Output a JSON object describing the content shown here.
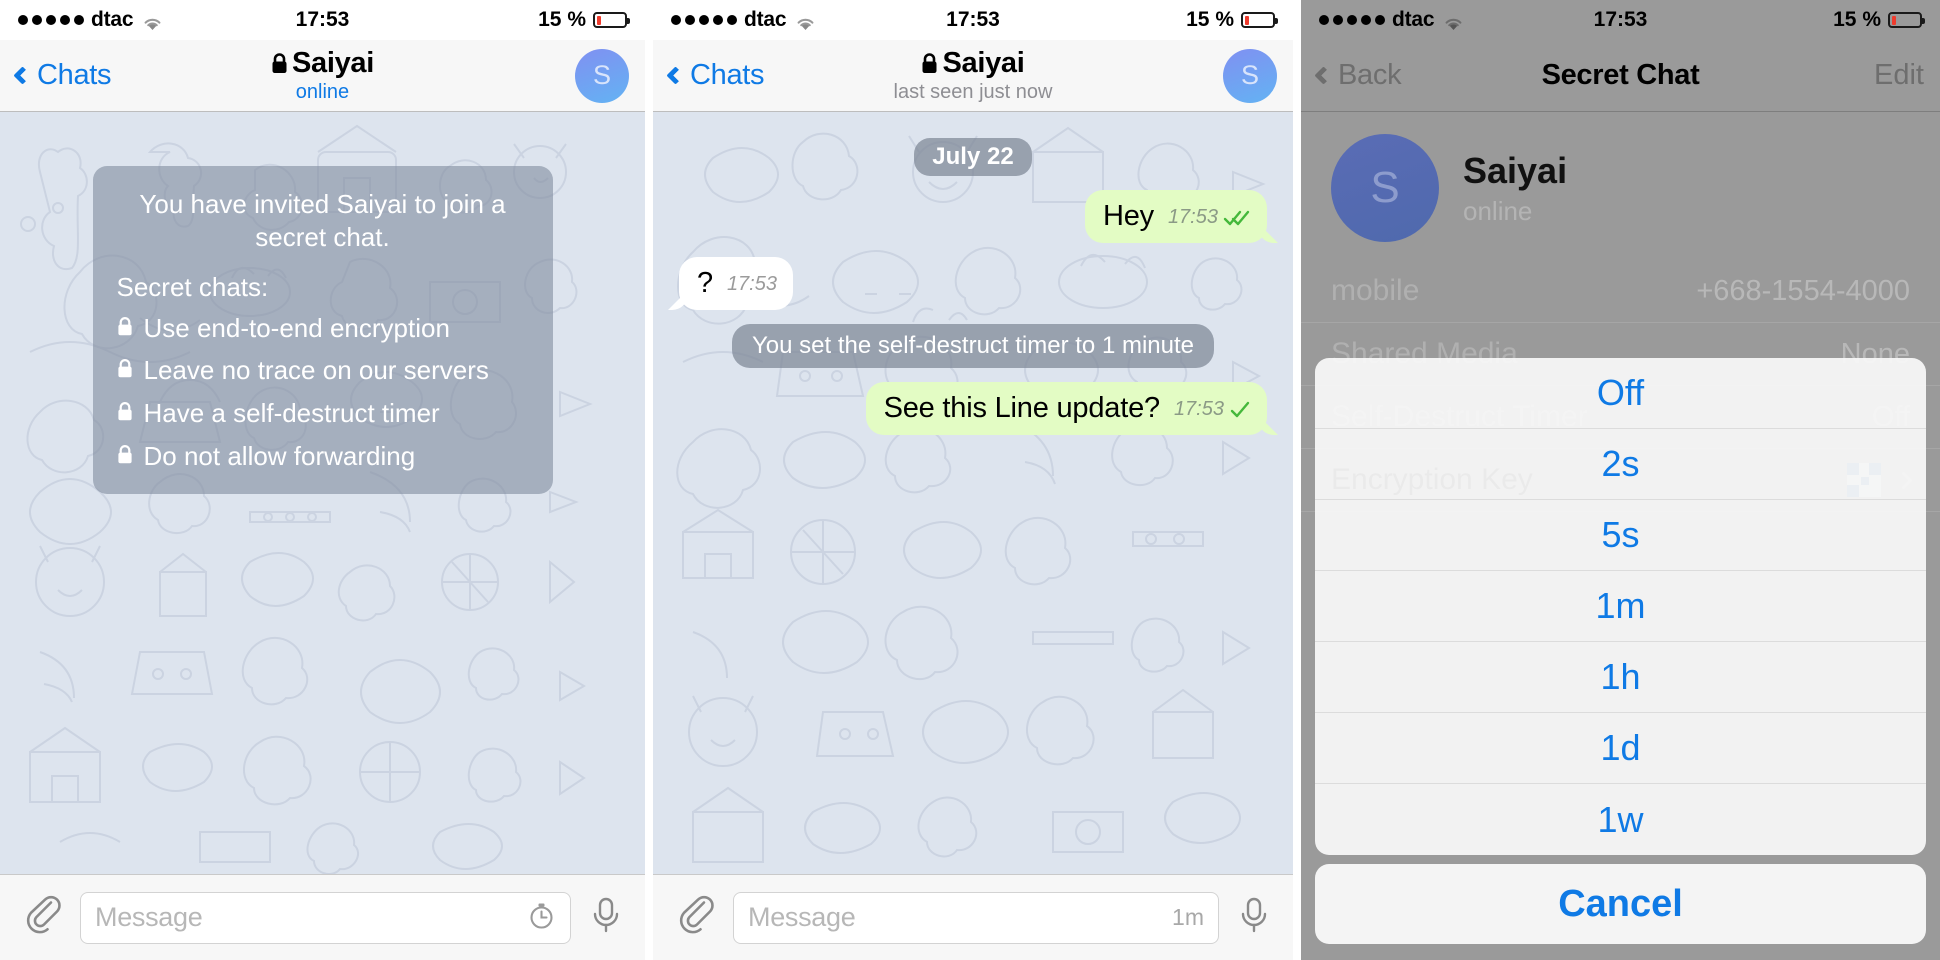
{
  "status_bar": {
    "carrier": "dtac",
    "signal_dots": 5,
    "wifi_icon": "wifi-icon",
    "time": "17:53",
    "battery_percent": "15 %",
    "battery_level": 15,
    "battery_color": "#ef3b2d"
  },
  "colors": {
    "accent_blue": "#0f7ae5",
    "outgoing_bubble": "#e3fcc4",
    "incoming_bubble": "#ffffff",
    "chat_background": "#dde4ee",
    "service_bubble": "rgba(125,135,150,.72)",
    "dimmed_overlay": "#9a9a9a",
    "tick_green": "#45b83b"
  },
  "panel1": {
    "nav": {
      "back_label": "Chats",
      "title": "Saiyai",
      "lock_icon": "lock-icon",
      "subtitle": "online",
      "avatar_initial": "S"
    },
    "info_bubble": {
      "heading": "You have invited Saiyai to join a secret chat.",
      "subheading": "Secret chats:",
      "items": [
        "Use end-to-end encryption",
        "Leave no trace on our servers",
        "Have a self-destruct timer",
        "Do not allow forwarding"
      ]
    },
    "input": {
      "attach_icon": "paperclip-icon",
      "placeholder": "Message",
      "timer_icon": "stopwatch-icon",
      "mic_icon": "microphone-icon"
    }
  },
  "panel2": {
    "nav": {
      "back_label": "Chats",
      "title": "Saiyai",
      "lock_icon": "lock-icon",
      "subtitle": "last seen just now",
      "avatar_initial": "S"
    },
    "date_separator": "July 22",
    "messages": [
      {
        "kind": "outgoing",
        "text": "Hey",
        "time": "17:53",
        "ticks": 2
      },
      {
        "kind": "incoming",
        "text": "?",
        "time": "17:53",
        "ticks": 0
      },
      {
        "kind": "service",
        "text": "You set the self-destruct timer to 1 minute"
      },
      {
        "kind": "outgoing",
        "text": "See this Line update?",
        "time": "17:53",
        "ticks": 1
      }
    ],
    "input": {
      "attach_icon": "paperclip-icon",
      "placeholder": "Message",
      "timer_value": "1m",
      "mic_icon": "microphone-icon"
    }
  },
  "panel3": {
    "nav": {
      "back_label": "Back",
      "title": "Secret Chat",
      "edit_label": "Edit"
    },
    "profile": {
      "avatar_initial": "S",
      "name": "Saiyai",
      "status": "online"
    },
    "rows": [
      {
        "label": "mobile",
        "value": "+668-1554-4000"
      },
      {
        "label": "Shared Media",
        "value": "None"
      },
      {
        "label": "Self-Destruct Timer",
        "value": "Off"
      },
      {
        "label": "Encryption Key",
        "value": "qr-code-icon"
      }
    ],
    "action_sheet": {
      "options": [
        "Off",
        "2s",
        "5s",
        "1m",
        "1h",
        "1d",
        "1w"
      ],
      "cancel_label": "Cancel"
    }
  }
}
